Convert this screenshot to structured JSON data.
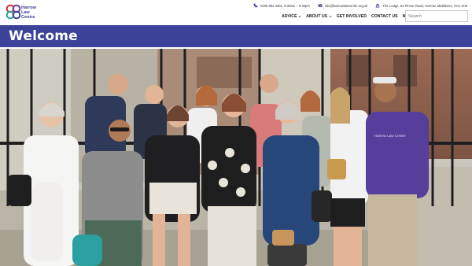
{
  "brand": {
    "name_line1": "Harrow",
    "name_line2": "Law",
    "name_line3": "Centre",
    "colors": {
      "primary": "#3a4397",
      "red": "#d9302c",
      "green": "#2aa3a0",
      "purple": "#6a3fa0"
    }
  },
  "topbar": {
    "phone": "0208 863 4301, 9:30am – 5:30pm",
    "email": "info@harrowlawcentre.org.uk",
    "address": "The Lodge, 64 Pinner Road, Harrow, Middlesex, HA1 4HZ",
    "phone_icon": "phone-icon",
    "email_icon": "envelope-icon",
    "address_icon": "building-icon"
  },
  "nav": {
    "items": [
      {
        "label": "ADVICE",
        "dropdown": true
      },
      {
        "label": "ABOUT US",
        "dropdown": true
      },
      {
        "label": "GET INVOLVED",
        "dropdown": false
      },
      {
        "label": "CONTACT US",
        "dropdown": false
      },
      {
        "label": "NEWS",
        "dropdown": false
      }
    ],
    "search_placeholder": "Search"
  },
  "banner": {
    "title": "Welcome"
  },
  "photo": {
    "shirt_text": "Harrow Law Centre"
  }
}
